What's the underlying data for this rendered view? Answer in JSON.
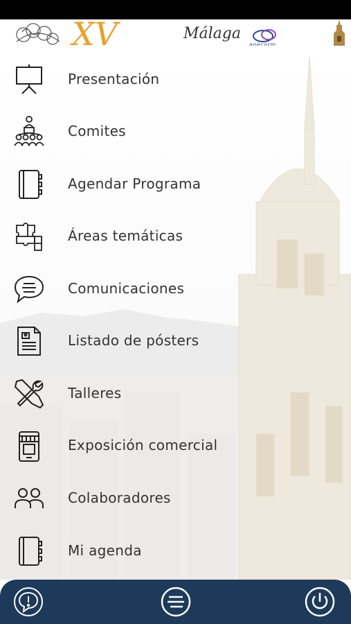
{
  "banner": {
    "city_logo": "Málaga",
    "congress_logo": "anecorm"
  },
  "menu": {
    "items": [
      {
        "label": "Presentación",
        "icon": "presentation-board-icon"
      },
      {
        "label": "Comites",
        "icon": "committee-icon"
      },
      {
        "label": "Agendar Programa",
        "icon": "notebook-icon"
      },
      {
        "label": "Áreas temáticas",
        "icon": "puzzle-icon"
      },
      {
        "label": "Comunicaciones",
        "icon": "speech-bubble-icon"
      },
      {
        "label": "Listado de pósters",
        "icon": "poster-document-icon"
      },
      {
        "label": "Talleres",
        "icon": "tools-icon"
      },
      {
        "label": "Exposición comercial",
        "icon": "shop-phone-icon"
      },
      {
        "label": "Colaboradores",
        "icon": "people-icon"
      },
      {
        "label": "Mi agenda",
        "icon": "notebook-icon"
      }
    ]
  },
  "tabbar": {
    "items": [
      {
        "icon": "alert-bubble-icon"
      },
      {
        "icon": "menu-icon"
      },
      {
        "icon": "power-icon"
      }
    ]
  },
  "colors": {
    "tabbar": "#1e3a5a",
    "text": "#333333",
    "banner_accent": "#e8a02b"
  }
}
